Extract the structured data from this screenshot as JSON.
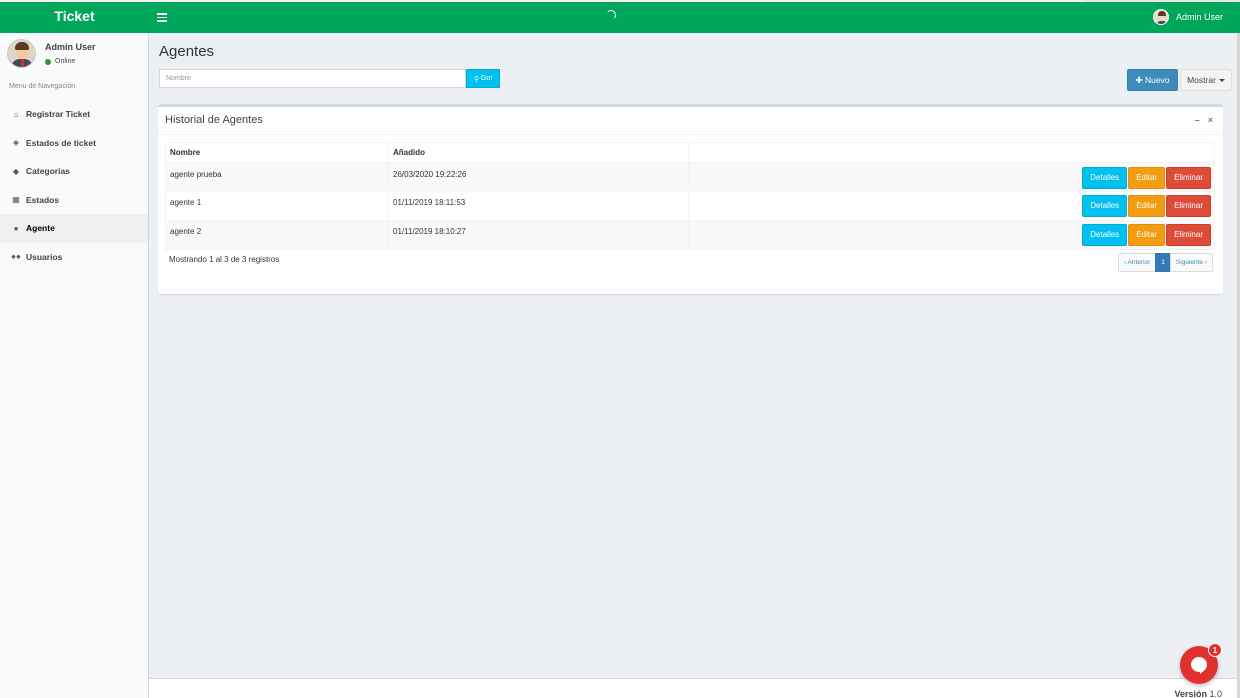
{
  "header": {
    "brand": "Ticket",
    "user_name": "Admin User"
  },
  "sidebar": {
    "user_name": "Admin User",
    "status": "Online",
    "nav_header": "Menu de Navegación",
    "items": [
      {
        "label": "Registrar Ticket",
        "icon": "home-icon"
      },
      {
        "label": "Estados de ticket",
        "icon": "ticket-icon"
      },
      {
        "label": "Categorias",
        "icon": "tag-icon"
      },
      {
        "label": "Estados",
        "icon": "grid-icon"
      },
      {
        "label": "Agente",
        "icon": "user-icon",
        "active": true
      },
      {
        "label": "Usuarios",
        "icon": "users-icon"
      }
    ]
  },
  "main": {
    "title": "Agentes",
    "search_placeholder": "Nombre",
    "go_label": "Go!",
    "new_label": "Nuevo",
    "show_label": "Mostrar"
  },
  "box": {
    "title": "Historial de Agentes",
    "columns": [
      "Nombre",
      "Añadido",
      ""
    ],
    "rows": [
      {
        "nombre": "agente prueba",
        "added": "26/03/2020 19:22:26"
      },
      {
        "nombre": "agente 1",
        "added": "01/11/2019 18:11:53"
      },
      {
        "nombre": "agente 2",
        "added": "01/11/2019 18:10:27"
      }
    ],
    "action_labels": {
      "details": "Detalles",
      "edit": "Editar",
      "delete": "Eliminar"
    },
    "info_text": "Mostrando 1 al 3 de 3 registros",
    "pagination": {
      "prev": "‹ Anterior",
      "current": "1",
      "next": "Siguiente ›"
    }
  },
  "footer": {
    "version_label": "Versión",
    "version_value": "1.0"
  },
  "chat": {
    "badge_count": "1"
  },
  "colors": {
    "header": "#00a65a",
    "primary": "#3c8dbc",
    "info": "#00c0ef",
    "warning": "#f39c12",
    "danger": "#dd4b39"
  }
}
